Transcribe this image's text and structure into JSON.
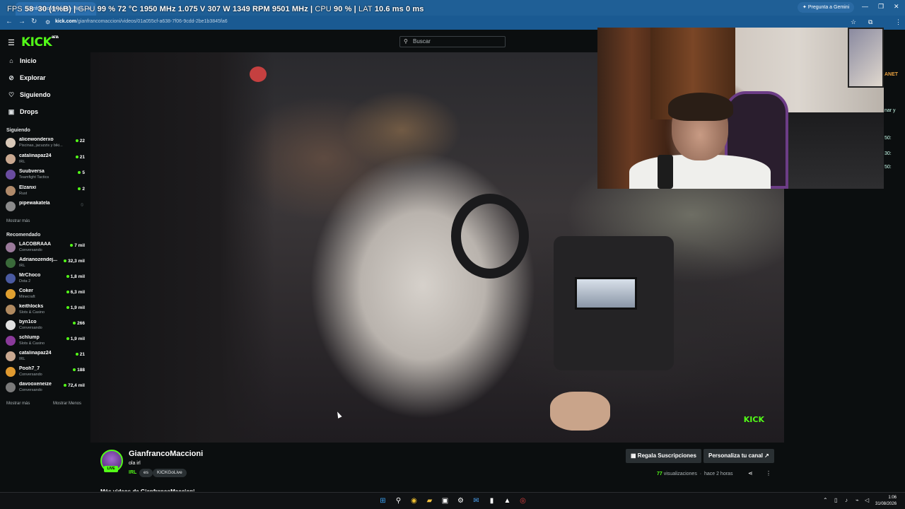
{
  "browser": {
    "tab_title": "GianfrancoMaccioni - Wat...",
    "url_domain": "kick.com",
    "url_path": "/gianfrancomaccioni/videos/01a055cf-a638-7f06-9cdd-2be1b3845fa6",
    "gemini_label": "Pregunta a Gemini"
  },
  "osd": {
    "fps_label": "FPS",
    "fps_value": "58",
    "fps_low": "30 (1%B)",
    "gpu_label": "GPU",
    "gpu_util": "99 %",
    "gpu_temp": "72 °C",
    "gpu_clock": "1950 MHz",
    "gpu_volt": "1.075 V",
    "gpu_power": "307 W",
    "gpu_fan": "1349 RPM",
    "gpu_mem": "9501 MHz",
    "cpu_label": "CPU",
    "cpu_util": "90 %",
    "lat_label": "LAT",
    "lat_value": "10.6 ms",
    "lat_value2": "0 ms"
  },
  "kick": {
    "logo": "KICK",
    "logo_beta": "BETA",
    "search_placeholder": "Buscar",
    "nav": [
      {
        "label": "Inicio",
        "icon": "home-icon"
      },
      {
        "label": "Explorar",
        "icon": "compass-icon"
      },
      {
        "label": "Siguiendo",
        "icon": "heart-icon"
      },
      {
        "label": "Drops",
        "icon": "gift-icon"
      }
    ],
    "following_title": "Siguiendo",
    "following": [
      {
        "name": "alicewonderxo",
        "sub": "Piscinas, jacuzzis y biki...",
        "viewers": "22",
        "color": "#d8c8b8"
      },
      {
        "name": "catalinapaz24",
        "sub": "IRL",
        "viewers": "21",
        "color": "#c9a890"
      },
      {
        "name": "Suubversa",
        "sub": "Teamfight Tactics",
        "viewers": "5",
        "color": "#6a4ca0"
      },
      {
        "name": "Elzanxi",
        "sub": "Rust",
        "viewers": "2",
        "color": "#b08a6a"
      },
      {
        "name": "pipewakatela",
        "sub": "",
        "viewers": "",
        "color": "#8a8a8a"
      }
    ],
    "show_more": "Mostrar más",
    "recommended_title": "Recomendado",
    "recommended": [
      {
        "name": "LACOBRAAA",
        "sub": "Conversando",
        "viewers": "7 mil",
        "color": "#9a7a9a"
      },
      {
        "name": "Adrianozendej...",
        "sub": "IRL",
        "viewers": "32,3 mil",
        "color": "#3a6a3a"
      },
      {
        "name": "MrChoco",
        "sub": "Dota 2",
        "viewers": "1,8 mil",
        "color": "#4a5aa0"
      },
      {
        "name": "Coker",
        "sub": "Minecraft",
        "viewers": "6,3 mil",
        "color": "#e0a030"
      },
      {
        "name": "keithlocks",
        "sub": "Slots & Casino",
        "viewers": "1,9 mil",
        "color": "#b08a60"
      },
      {
        "name": "byn1co",
        "sub": "Conversando",
        "viewers": "266",
        "color": "#e0e0e0"
      },
      {
        "name": "schlump",
        "sub": "Slots & Casino",
        "viewers": "1,9 mil",
        "color": "#8a3a9a"
      },
      {
        "name": "catalinapaz24",
        "sub": "IRL",
        "viewers": "21",
        "color": "#c9a890"
      },
      {
        "name": "Pooh7_7",
        "sub": "Conversando",
        "viewers": "188",
        "color": "#e09a30"
      },
      {
        "name": "davooxeneize",
        "sub": "Conversando",
        "viewers": "72,4 mil",
        "color": "#7a7a7a"
      }
    ],
    "show_more_2": "Mostrar más",
    "show_less": "Mostrar Menos",
    "watermark": "KICK"
  },
  "stream": {
    "streamer": "GianfrancoMaccioni",
    "live_badge": "LIVE",
    "title": "ola irl",
    "category": "IRL",
    "tags": [
      "es",
      "KICKGoLive"
    ],
    "gift_subs_label": "Regala Suscripciones",
    "customize_label": "Personaliza tu canal",
    "views_count": "77",
    "views_label": "visualizaciones",
    "time_ago": "hace 2 horas",
    "more_videos": "Más videos de GianfrancoMaccioni"
  },
  "chat_fragments": [
    "ANET",
    "nar y",
    "50:",
    "30:",
    "50:"
  ],
  "taskbar": {
    "time": "1:06",
    "date": "31/08/2026"
  }
}
